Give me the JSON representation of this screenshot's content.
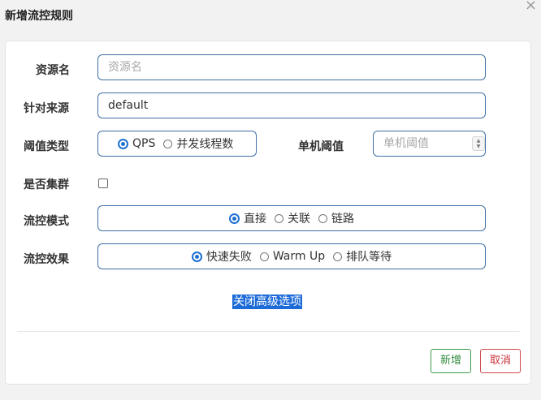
{
  "dialog": {
    "title": "新增流控规则",
    "close_glyph": "×"
  },
  "form": {
    "resource_name": {
      "label": "资源名",
      "placeholder": "资源名",
      "value": ""
    },
    "limit_app": {
      "label": "针对来源",
      "value": "default"
    },
    "threshold_type": {
      "label": "阈值类型",
      "options": [
        "QPS",
        "并发线程数"
      ],
      "selected": "QPS"
    },
    "single_threshold": {
      "label": "单机阈值",
      "placeholder": "单机阈值",
      "value": ""
    },
    "cluster_mode": {
      "label": "是否集群",
      "checked": false
    },
    "strategy": {
      "label": "流控模式",
      "options": [
        "直接",
        "关联",
        "链路"
      ],
      "selected": "直接"
    },
    "control_behavior": {
      "label": "流控效果",
      "options": [
        "快速失败",
        "Warm Up",
        "排队等待"
      ],
      "selected": "快速失败"
    },
    "advanced_link": "关闭高级选项"
  },
  "footer": {
    "add_label": "新增",
    "cancel_label": "取消"
  },
  "colors": {
    "accent": "#1f6fd1",
    "input_border": "#3f6fa3",
    "add_green": "#2e8b3c",
    "cancel_red": "#c8333b",
    "link_highlight": "#1d6bd8"
  },
  "icons": {
    "close": "close-icon",
    "stepper": "stepper-arrows-icon"
  }
}
